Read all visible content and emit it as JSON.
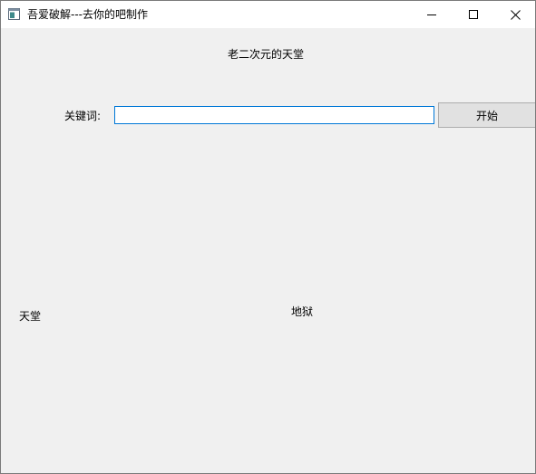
{
  "window": {
    "title": "吾爱破解---去你的吧制作",
    "icon": "app-window-icon"
  },
  "header": {
    "text": "老二次元的天堂"
  },
  "search": {
    "label": "关键词:",
    "value": "",
    "button_label": "开始"
  },
  "labels": {
    "left": "天堂",
    "center": "地狱"
  },
  "colors": {
    "window_bg": "#f0f0f0",
    "titlebar_bg": "#ffffff",
    "input_border": "#0078d7",
    "button_bg": "#e1e1e1"
  }
}
